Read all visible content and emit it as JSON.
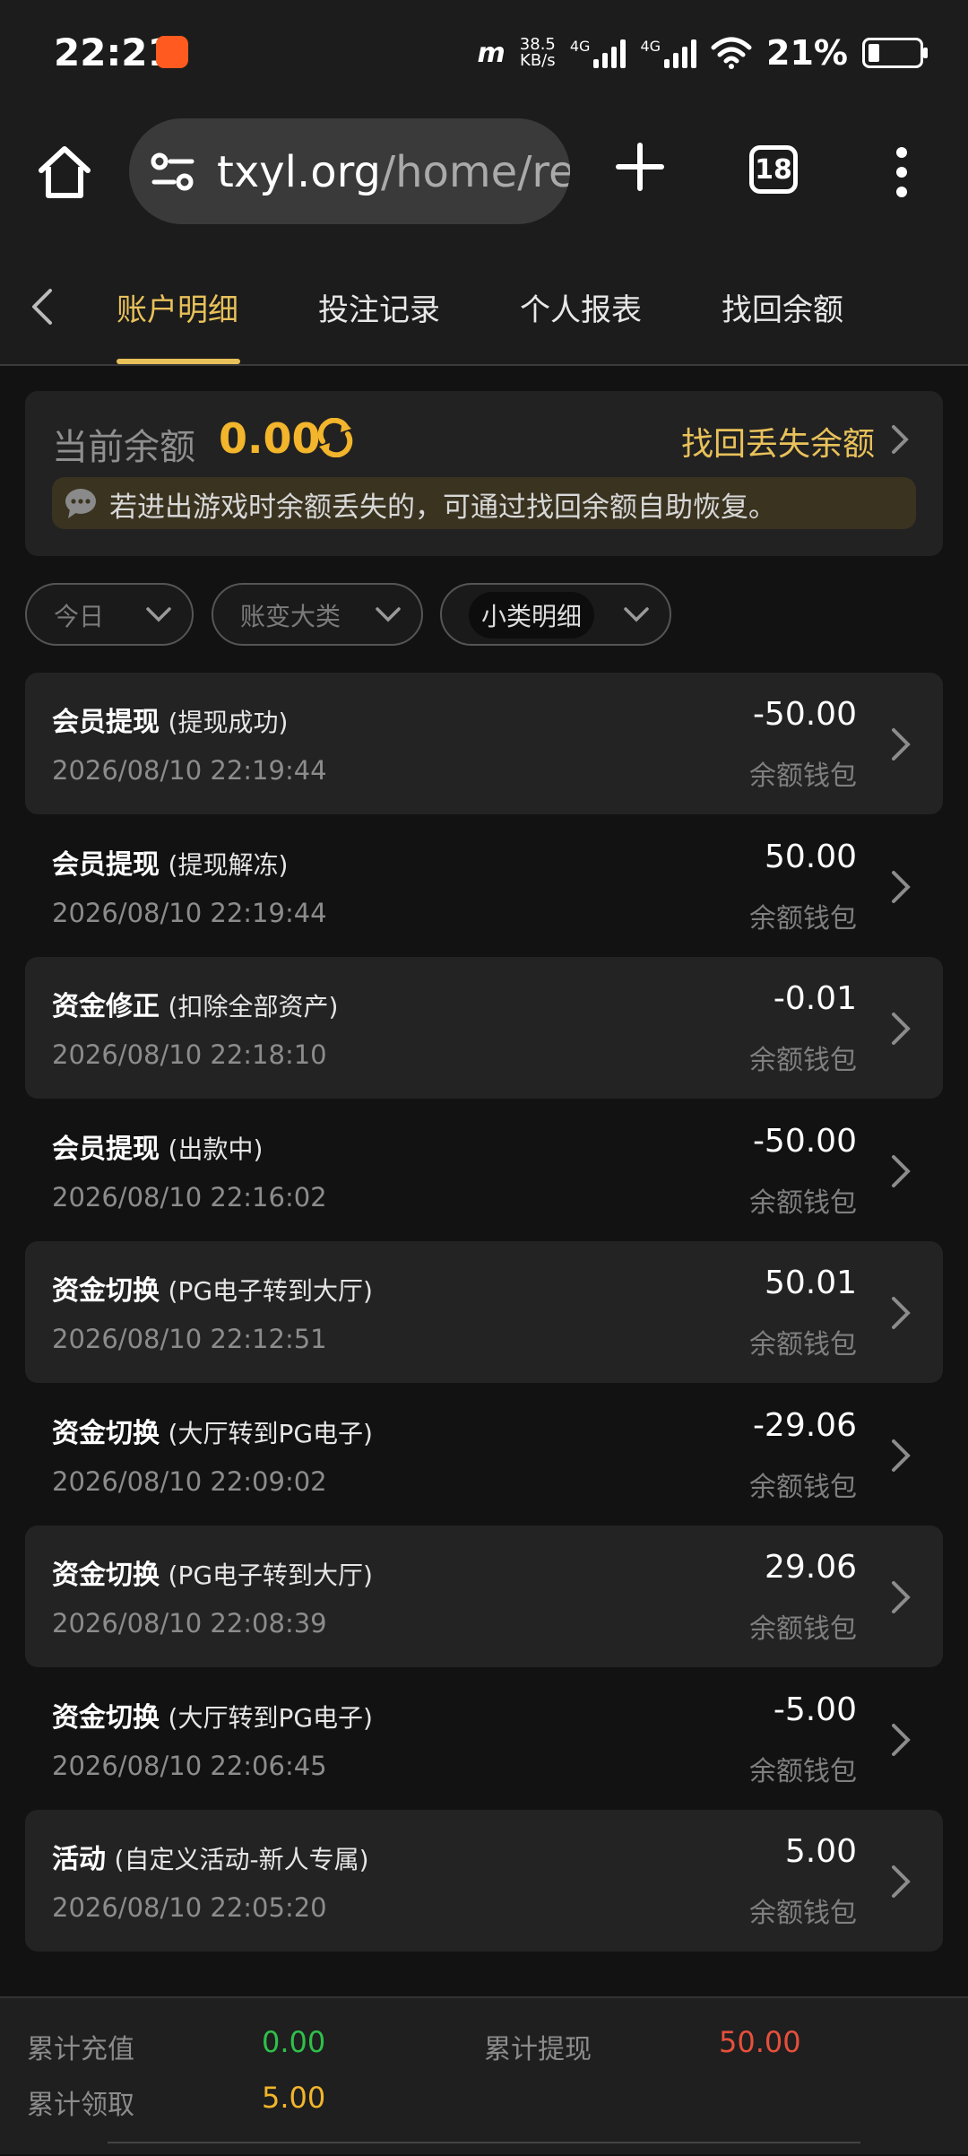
{
  "status_bar": {
    "time": "22:21",
    "net_speed_value": "38.5",
    "net_speed_unit": "KB/s",
    "net_brand": "m",
    "sim1": "4G",
    "sim2": "4G",
    "battery_percent": "21%"
  },
  "browser": {
    "url_host": "txyl.org",
    "url_path": "/home/rep",
    "tab_count": "18"
  },
  "tabs": {
    "items": [
      "账户明细",
      "投注记录",
      "个人报表",
      "找回余额"
    ],
    "active_index": 0
  },
  "balance": {
    "label": "当前余额",
    "value": "0.00",
    "recover_link": "找回丢失余额",
    "notice": "若进出游戏时余额丢失的，可通过找回余额自助恢复。"
  },
  "filters": [
    {
      "label": "今日"
    },
    {
      "label": "账变大类"
    },
    {
      "label": "小类明细"
    }
  ],
  "records": [
    {
      "type": "会员提现",
      "detail": "(提现成功)",
      "time": "2026/08/10 22:19:44",
      "amount": "-50.00",
      "wallet": "余额钱包"
    },
    {
      "type": "会员提现",
      "detail": "(提现解冻)",
      "time": "2026/08/10 22:19:44",
      "amount": "50.00",
      "wallet": "余额钱包"
    },
    {
      "type": "资金修正",
      "detail": "(扣除全部资产)",
      "time": "2026/08/10 22:18:10",
      "amount": "-0.01",
      "wallet": "余额钱包"
    },
    {
      "type": "会员提现",
      "detail": "(出款中)",
      "time": "2026/08/10 22:16:02",
      "amount": "-50.00",
      "wallet": "余额钱包"
    },
    {
      "type": "资金切换",
      "detail": "(PG电子转到大厅)",
      "time": "2026/08/10 22:12:51",
      "amount": "50.01",
      "wallet": "余额钱包"
    },
    {
      "type": "资金切换",
      "detail": "(大厅转到PG电子)",
      "time": "2026/08/10 22:09:02",
      "amount": "-29.06",
      "wallet": "余额钱包"
    },
    {
      "type": "资金切换",
      "detail": "(PG电子转到大厅)",
      "time": "2026/08/10 22:08:39",
      "amount": "29.06",
      "wallet": "余额钱包"
    },
    {
      "type": "资金切换",
      "detail": "(大厅转到PG电子)",
      "time": "2026/08/10 22:06:45",
      "amount": "-5.00",
      "wallet": "余额钱包"
    },
    {
      "type": "活动",
      "detail": "(自定义活动-新人专属)",
      "time": "2026/08/10 22:05:20",
      "amount": "5.00",
      "wallet": "余额钱包"
    }
  ],
  "summary": {
    "recharge_label": "累计充值",
    "recharge_value": "0.00",
    "withdraw_label": "累计提现",
    "withdraw_value": "50.00",
    "claim_label": "累计领取",
    "claim_value": "5.00"
  },
  "colors": {
    "accent_gold": "#e8c15a",
    "balance_orange": "#f2b52b",
    "green": "#2fbf4a",
    "red": "#e5503c"
  }
}
